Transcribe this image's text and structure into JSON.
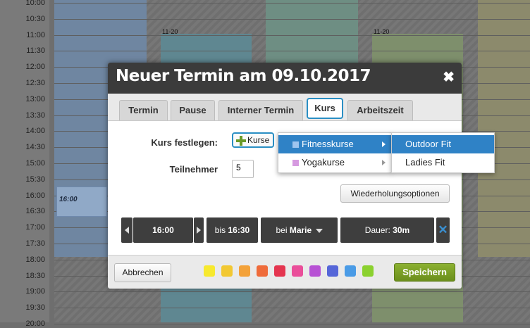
{
  "calendar": {
    "times": [
      "10:00",
      "10:30",
      "11:00",
      "11:30",
      "12:00",
      "12:30",
      "13:00",
      "13:30",
      "14:00",
      "14:30",
      "15:00",
      "15:30",
      "16:00",
      "16:30",
      "17:00",
      "17:30",
      "18:00",
      "18:30",
      "19:00",
      "19:30",
      "20:00"
    ],
    "day_labels": [
      "11-20",
      "11-20"
    ],
    "event_time": "16:00"
  },
  "dialog": {
    "title": "Neuer Termin am 09.10.2017",
    "close_symbol": "✖",
    "tabs": [
      "Termin",
      "Pause",
      "Interner Termin",
      "Kurs",
      "Arbeitszeit"
    ],
    "active_tab": "Kurs",
    "kurs_label": "Kurs festlegen:",
    "kurs_button": "Kurse",
    "teilnehmer_label": "Teilnehmer",
    "teilnehmer_value": "5",
    "repeat_button": "Wiederholungsoptionen",
    "time_start": "16:00",
    "time_end_prefix": "bis",
    "time_end": "16:30",
    "person_prefix": "bei",
    "person": "Marie",
    "duration_prefix": "Dauer:",
    "duration": "30m",
    "cancel_button": "Abbrechen",
    "save_button": "Speichern",
    "color_swatches": [
      "#f7e92e",
      "#f2c832",
      "#f3a23a",
      "#ef6b3a",
      "#e4354f",
      "#ea4e9a",
      "#b751d4",
      "#5566d8",
      "#4a9be6",
      "#8bd12f"
    ]
  },
  "menu": {
    "categories": [
      {
        "label": "Fitnesskurse",
        "color": "#9ec5ef",
        "selected": true
      },
      {
        "label": "Yogakurse",
        "color": "#d69ae0",
        "selected": false
      }
    ],
    "subitems": [
      {
        "label": "Outdoor Fit",
        "selected": true
      },
      {
        "label": "Ladies Fit",
        "selected": false
      }
    ]
  },
  "colors": {
    "accent": "#2a8fc4",
    "menu_selected": "#2f82c6",
    "save_green": "#7aa126",
    "header_dark": "#3b3b3b"
  }
}
